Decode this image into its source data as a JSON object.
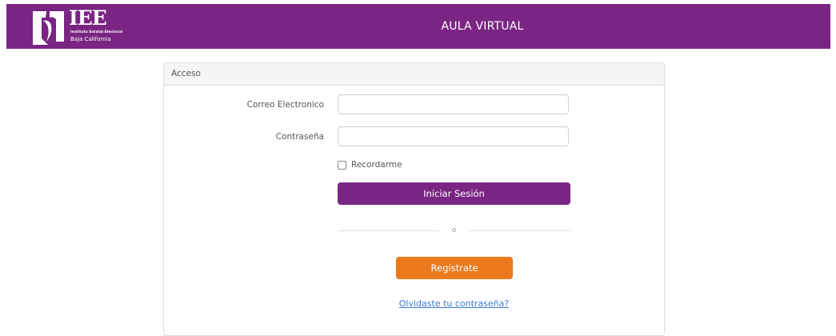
{
  "header": {
    "logo_text": "IEE",
    "logo_subtitle_1": "Instituto Estatal Electoral",
    "logo_subtitle_2": "Baja California",
    "title": "AULA VIRTUAL",
    "background_color": "#7a2583"
  },
  "login_card": {
    "header": "Acceso",
    "email_label": "Correo Electronico",
    "email_value": "",
    "password_label": "Contraseña",
    "password_value": "",
    "remember_label": "Recordarme",
    "remember_checked": false,
    "login_button": "Iniciar Sesión",
    "divider_text": "o",
    "register_button": "Regístrate",
    "forgot_link": "Olvidaste tu contraseña?"
  },
  "colors": {
    "primary": "#7a2583",
    "register": "#ec7a1c",
    "link": "#3a7bd5"
  }
}
